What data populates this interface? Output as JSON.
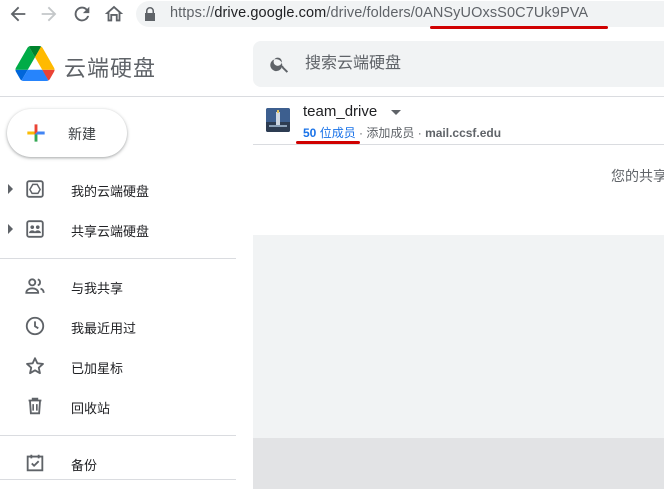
{
  "browser": {
    "url_scheme": "https://",
    "url_host": "drive.google.com",
    "url_path": "/drive/folders/",
    "url_folder_id": "0ANSyUOxsS0C7Uk9PVA"
  },
  "header": {
    "app_title": "云端硬盘",
    "search_placeholder": "搜索云端硬盘"
  },
  "sidebar": {
    "new_label": "新建",
    "items": [
      {
        "label": "我的云端硬盘",
        "icon": "my-drive-icon",
        "expandable": true
      },
      {
        "label": "共享云端硬盘",
        "icon": "shared-drives-icon",
        "expandable": true
      },
      {
        "label": "与我共享",
        "icon": "people-icon",
        "expandable": false
      },
      {
        "label": "我最近用过",
        "icon": "clock-icon",
        "expandable": false
      },
      {
        "label": "已加星标",
        "icon": "star-icon",
        "expandable": false
      },
      {
        "label": "回收站",
        "icon": "trash-icon",
        "expandable": false
      },
      {
        "label": "备份",
        "icon": "backup-icon",
        "expandable": false
      }
    ]
  },
  "main": {
    "drive_name": "team_drive",
    "member_count": "50",
    "member_suffix": " 位成员",
    "separator": " · ",
    "add_member": "添加成员",
    "domain": "mail.ccsf.edu",
    "shared_hint": "您的共享"
  },
  "colors": {
    "accent": "#1a73e8",
    "annotation_red": "#d00000"
  }
}
